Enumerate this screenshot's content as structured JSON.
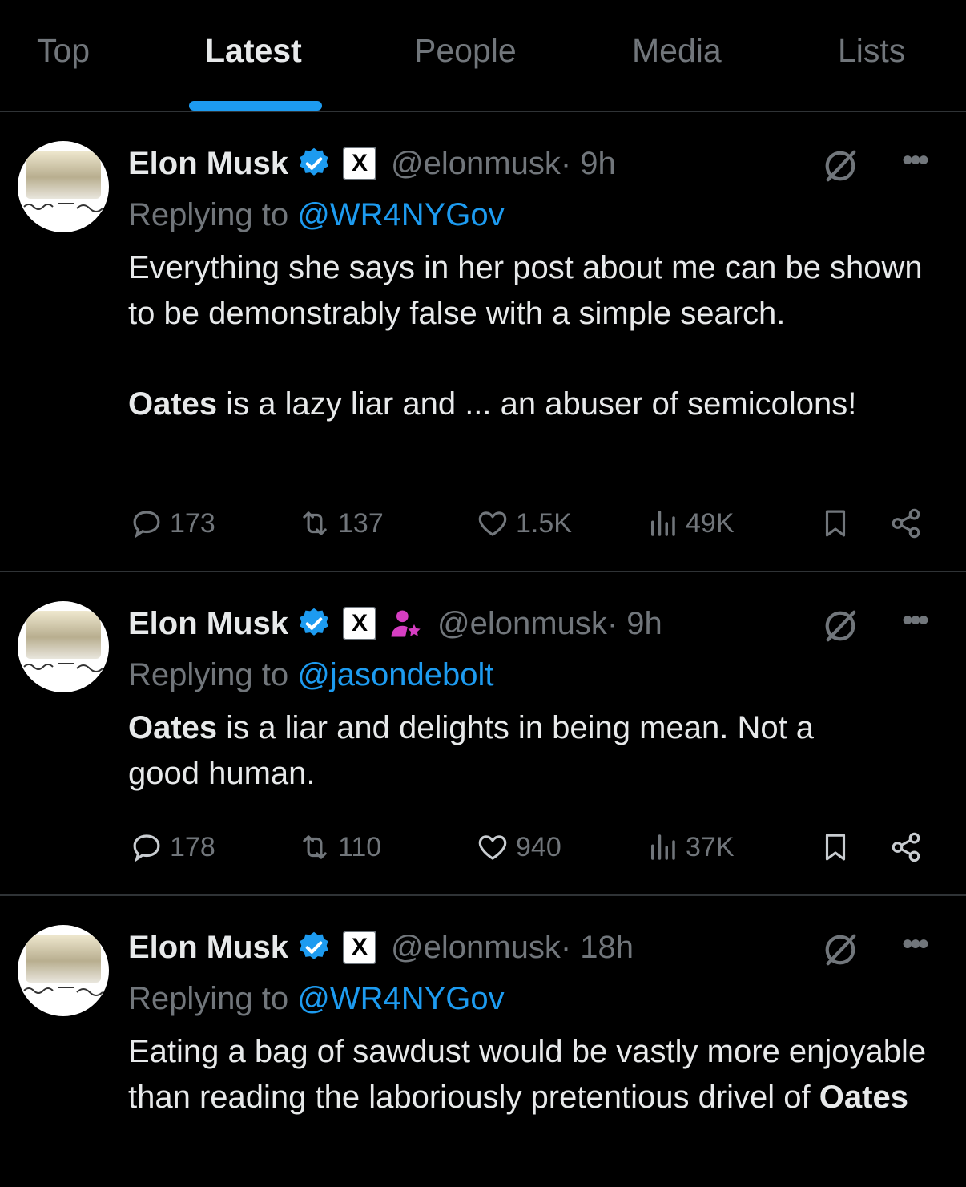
{
  "tabs": [
    {
      "label": "Top",
      "active": false
    },
    {
      "label": "Latest",
      "active": true
    },
    {
      "label": "People",
      "active": false
    },
    {
      "label": "Media",
      "active": false
    },
    {
      "label": "Lists",
      "active": false
    }
  ],
  "colors": {
    "background": "#000000",
    "text": "#e7e9ea",
    "secondary": "#71767b",
    "accent": "#1d9bf0",
    "divider": "#2f3336",
    "badge_pink": "#d63ec2"
  },
  "tweets": [
    {
      "author": "Elon Musk",
      "handle": "@elonmusk",
      "time": " · 9h",
      "x_badge": "X",
      "icons": [
        "verified-icon",
        "x-affiliation-icon",
        "grok-icon",
        "more-icon"
      ],
      "reply_prefix": "Replying to ",
      "reply_to": "@WR4NYGov",
      "body_1": "Everything she says in her post about me can be shown to be demonstrably false with a simple search.",
      "body_2_bold": "Oates",
      "body_2": " is a lazy liar and ... an abuser of semicolons!",
      "replies": "173",
      "reposts": "137",
      "likes": "1.5K",
      "views": "49K"
    },
    {
      "author": "Elon Musk",
      "handle": "@elonmusk",
      "time": " · 9h",
      "x_badge": "X",
      "icons": [
        "verified-icon",
        "x-affiliation-icon",
        "person-star-icon",
        "grok-icon",
        "more-icon"
      ],
      "reply_prefix": "Replying to ",
      "reply_to": "@jasondebolt",
      "body_1_bold": "Oates",
      "body_1": " is a liar and delights in being mean. Not a good human.",
      "replies": "178",
      "reposts": "110",
      "likes": "940",
      "views": "37K"
    },
    {
      "author": "Elon Musk",
      "handle": "@elonmusk",
      "time": " · 18h",
      "x_badge": "X",
      "icons": [
        "verified-icon",
        "x-affiliation-icon",
        "grok-icon",
        "more-icon"
      ],
      "reply_prefix": "Replying to ",
      "reply_to": "@WR4NYGov",
      "body_1": "Eating a bag of sawdust would be vastly more enjoyable than reading the laboriously pretentious drivel of ",
      "body_1_bold": "Oates"
    }
  ]
}
